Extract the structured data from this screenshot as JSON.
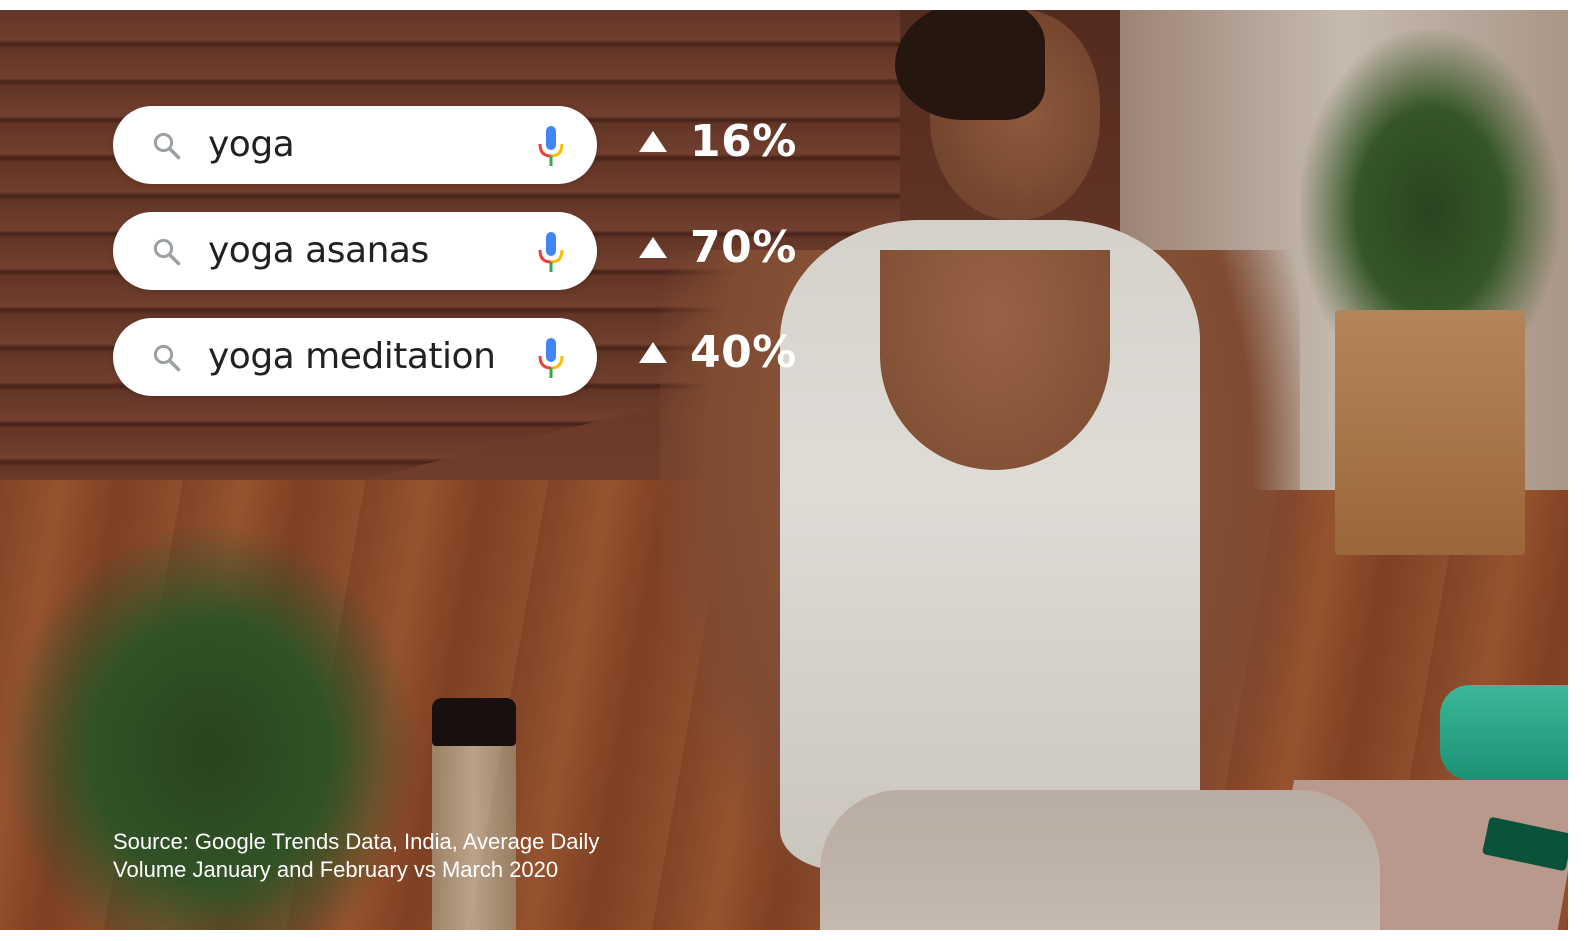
{
  "searches": [
    {
      "query": "yoga",
      "change": "16%"
    },
    {
      "query": "yoga asanas",
      "change": "70%"
    },
    {
      "query": "yoga meditation",
      "change": "40%"
    }
  ],
  "source_note": "Source: Google Trends Data, India, Average Daily Volume January and February vs March 2020",
  "icons": {
    "search": "search-icon",
    "mic": "microphone-icon",
    "trend": "up-triangle-icon"
  },
  "colors": {
    "pill_bg": "#ffffff",
    "query_text": "#202124",
    "stat_text": "#ffffff"
  }
}
